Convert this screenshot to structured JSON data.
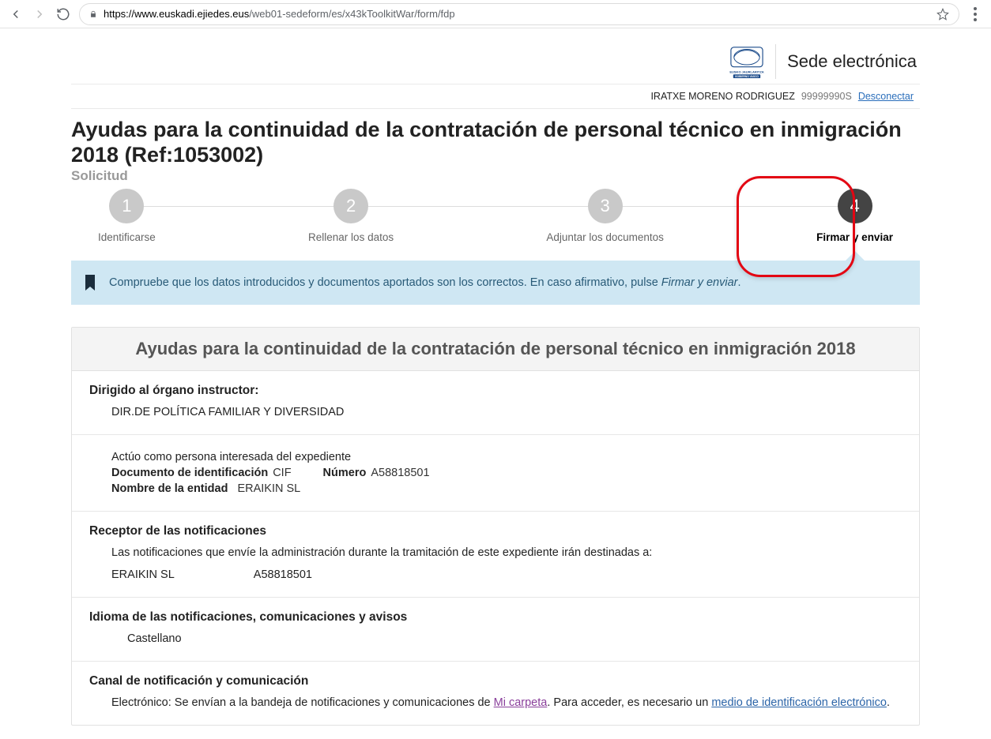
{
  "browser": {
    "url_host": "https://www.euskadi.ejiedes.eus",
    "url_path": "/web01-sedeform/es/x43kToolkitWar/form/fdp"
  },
  "header": {
    "site_name": "Sede electrónica"
  },
  "user_bar": {
    "name": "IRATXE MORENO RODRIGUEZ",
    "id": "99999990S",
    "logout": "Desconectar"
  },
  "title": "Ayudas para la continuidad de la contratación de personal técnico en inmigración 2018 (Ref:1053002)",
  "sub": "Solicitud",
  "stepper": {
    "s1": {
      "num": "1",
      "label": "Identificarse"
    },
    "s2": {
      "num": "2",
      "label": "Rellenar los datos"
    },
    "s3": {
      "num": "3",
      "label": "Adjuntar los documentos"
    },
    "s4": {
      "num": "4",
      "label": "Firmar y enviar"
    }
  },
  "banner": {
    "text_a": "Compruebe que los datos introducidos y documentos aportados son los correctos. En caso afirmativo, pulse ",
    "text_em": "Firmar y enviar",
    "text_b": "."
  },
  "panel": {
    "header": "Ayudas para la continuidad de la contratación de personal técnico en inmigración 2018",
    "dirigido": {
      "title": "Dirigido al órgano instructor:",
      "value": "DIR.DE POLÍTICA FAMILIAR Y DIVERSIDAD"
    },
    "interesado": {
      "line1": "Actúo como persona interesada del expediente",
      "doc_label": "Documento de identificación",
      "doc_type": "CIF",
      "num_label": "Número",
      "num_value": "A58818501",
      "entidad_label": "Nombre de la entidad",
      "entidad_value": "ERAIKIN SL"
    },
    "receptor": {
      "title": "Receptor de las notificaciones",
      "desc": "Las notificaciones que envíe la administración durante la tramitación de este expediente irán destinadas a:",
      "name": "ERAIKIN SL",
      "id": "A58818501"
    },
    "idioma": {
      "title": "Idioma de las notificaciones, comunicaciones y avisos",
      "value": "Castellano"
    },
    "canal": {
      "title": "Canal de notificación y comunicación",
      "pre": "Electrónico: Se envían a la bandeja de notificaciones y comunicaciones de ",
      "link1": "Mi carpeta",
      "mid": ". Para acceder, es necesario un ",
      "link2": "medio de identificación electrónico",
      "post": "."
    }
  }
}
